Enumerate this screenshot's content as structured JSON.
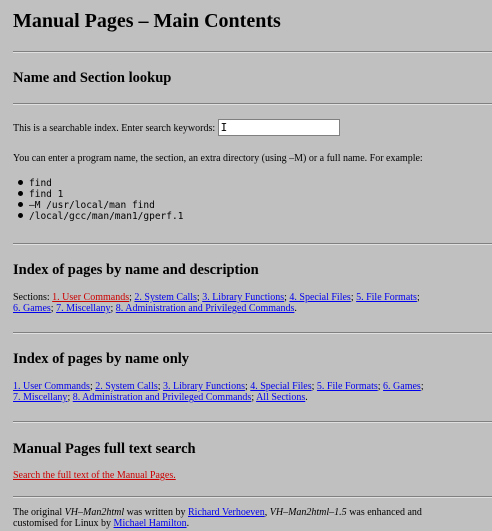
{
  "title": "Manual Pages – Main Contents",
  "lookup": {
    "heading": "Name and Section lookup",
    "prompt": "This is a searchable index. Enter search keywords:",
    "search_value": "",
    "hint": "You can enter a program name, the section, an extra directory (using –M) or a full name. For example:",
    "examples": [
      "find",
      "find 1",
      "–M /usr/local/man find",
      "/local/gcc/man/man1/gperf.1"
    ]
  },
  "by_name_desc": {
    "heading": "Index of pages by name and description",
    "prefix": "Sections: ",
    "links": [
      "1. User Commands",
      "2. System Calls",
      "3. Library Functions",
      "4. Special Files",
      "5. File Formats",
      "6. Games",
      "7. Miscellany",
      "8. Administration and Privileged Commands"
    ],
    "visited": [
      true,
      false,
      false,
      false,
      false,
      false,
      false,
      false
    ]
  },
  "by_name_only": {
    "heading": "Index of pages by name only",
    "links": [
      "1. User Commands",
      "2. System Calls",
      "3. Library Functions",
      "4. Special Files",
      "5. File Formats",
      "6. Games",
      "7. Miscellany",
      "8. Administration and Privileged Commands",
      "All Sections"
    ]
  },
  "fulltext": {
    "heading": "Manual Pages full text search",
    "link": "Search the full text of the Manual Pages."
  },
  "footer": {
    "t1": "The original ",
    "prog1": "VH–Man2html",
    "t2": " was written by ",
    "author1": "Richard Verhoeven",
    "t3": ", ",
    "prog2": "VH–Man2html–1.5",
    "t4": " was enhanced and",
    "t5": "customised for Linux by ",
    "author2": "Michael Hamilton",
    "t6": "."
  },
  "colors": {
    "background": "#c0c0c0",
    "link": "#0000ee",
    "visited": "#cc0000"
  }
}
